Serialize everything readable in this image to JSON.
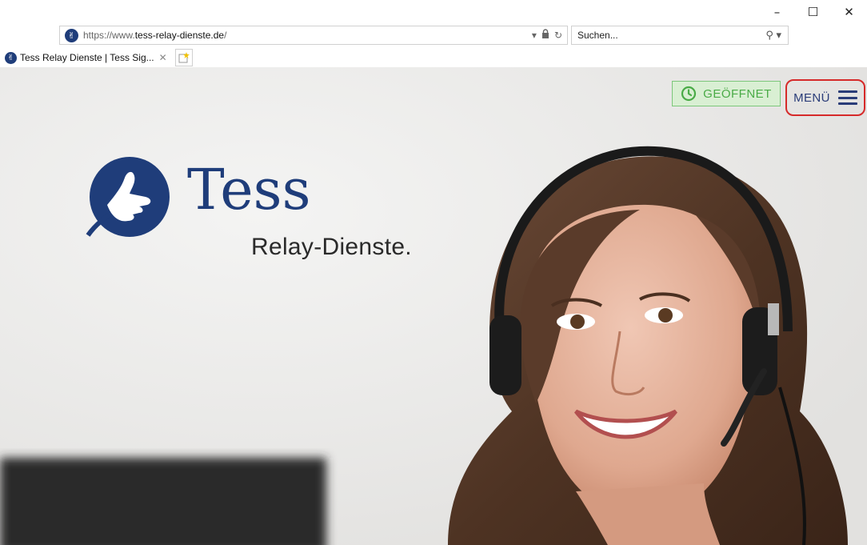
{
  "browser": {
    "url_prefix": "https://www.",
    "url_domain": "tess-relay-dienste.de",
    "url_suffix": "/",
    "search_placeholder": "Suchen...",
    "tab_title": "Tess Relay Dienste | Tess Sig...",
    "window_controls": {
      "minimize": "–",
      "maximize": "☐",
      "close": "✕"
    }
  },
  "page": {
    "status_label": "GEÖFFNET",
    "menu_label": "MENÜ",
    "logo": {
      "name": "Tess",
      "tagline": "Relay-Dienste."
    }
  },
  "colors": {
    "brand_blue": "#1f3d7a",
    "status_green": "#4aab47",
    "status_bg": "#d9efd3",
    "highlight_red": "#d62a2a"
  },
  "icons": [
    "site-favicon-icon",
    "lock-icon",
    "refresh-icon",
    "search-icon",
    "new-tab-icon",
    "clock-icon",
    "hamburger-icon"
  ]
}
